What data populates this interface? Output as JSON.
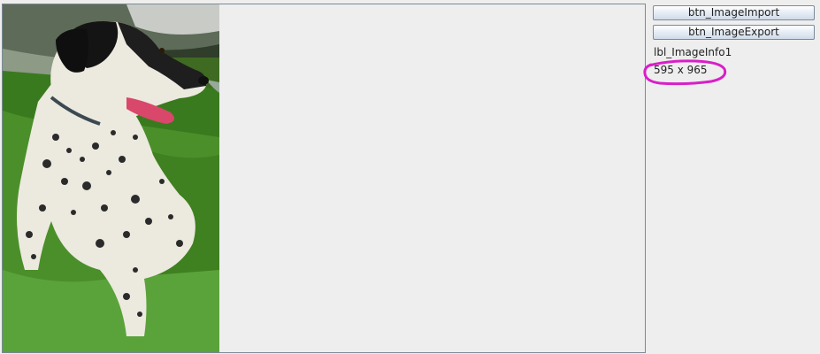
{
  "toolbar": {
    "import_label": "btn_ImageImport",
    "export_label": "btn_ImageExport"
  },
  "info": {
    "info_label": "lbl_ImageInfo1",
    "size_value": "595 x 965"
  },
  "image": {
    "subject": "dalmatian-mix dog sitting on grass"
  },
  "colors": {
    "annotation": "#d81fc8",
    "panel_border": "#7a8a99",
    "background": "#eeeeee"
  }
}
